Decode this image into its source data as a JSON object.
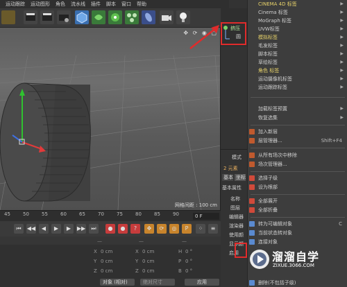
{
  "menubar": {
    "items": [
      "运动跟踪",
      "运动图形",
      "角色",
      "流水线",
      "插件",
      "脚本",
      "窗口",
      "帮助"
    ]
  },
  "objects": {
    "item1": "挤压",
    "item2": "圆"
  },
  "viewport": {
    "corner_icons": "✥ ⟳ ◉ ▢",
    "grid_readout": "网格间距 : 100 cm"
  },
  "timeline": {
    "ticks": [
      "45",
      "50",
      "55",
      "60",
      "65",
      "70",
      "75",
      "80",
      "85",
      "90"
    ],
    "frame_value": "0 F"
  },
  "coords": {
    "rows": [
      {
        "axis": "X",
        "pos": "0 cm",
        "size": "0 cm",
        "rot_axis": "H",
        "rot": "0 °"
      },
      {
        "axis": "Y",
        "pos": "0 cm",
        "size": "0 cm",
        "rot_axis": "P",
        "rot": "0 °"
      },
      {
        "axis": "Z",
        "pos": "0 cm",
        "size": "0 cm",
        "rot_axis": "B",
        "rot": "0 °"
      }
    ],
    "mode_select": "对象 (相对)",
    "size_select": "绝对尺寸",
    "apply_button": "应用"
  },
  "attr": {
    "mode_label": "模式",
    "elements_label": "2 元素",
    "base_tab": "基本",
    "coord_tab": "坐标",
    "basic_props": "基本属性",
    "name_label": "名称",
    "layer_label": "图层",
    "editor_label": "编辑器",
    "renderer_label": "渲染器",
    "use_color_label": "使用颜",
    "display_color_label": "显示颜",
    "enable_label": "启用"
  },
  "context_menu": {
    "items": [
      {
        "label": "CINEMA 4D 标签",
        "submenu": true,
        "style": "yellow"
      },
      {
        "label": "Cinema 标签",
        "submenu": true
      },
      {
        "label": "MoGraph 标签",
        "submenu": true
      },
      {
        "label": "UVW标签",
        "submenu": true
      },
      {
        "label": "模拟标签",
        "submenu": true,
        "style": "yellow"
      },
      {
        "label": "毛发标签",
        "submenu": true
      },
      {
        "label": "脚本标签",
        "submenu": true
      },
      {
        "label": "草绘标签",
        "submenu": true
      },
      {
        "label": "角色 标签",
        "submenu": true,
        "style": "yellow"
      },
      {
        "label": "运动摄像机标签",
        "submenu": true
      },
      {
        "label": "运动跟踪标签",
        "submenu": true
      },
      {
        "label": "加载标签预置",
        "submenu": true
      },
      {
        "label": "恢复选集",
        "submenu": true
      },
      {
        "label": "加入新层",
        "icon": "#c05a2e"
      },
      {
        "label": "层管理器...",
        "icon": "#c05a2e",
        "shortcut": "Shift+F4"
      },
      {
        "label": "从所有场次中移除",
        "icon": "#c05a2e"
      },
      {
        "label": "场次管理器...",
        "icon": "#c05a2e"
      },
      {
        "label": "选择子级",
        "icon": "#d04a3a"
      },
      {
        "label": "设为根部",
        "icon": "#d04a3a"
      },
      {
        "label": "全部展开",
        "icon": "#d04a3a"
      },
      {
        "label": "全部折叠",
        "icon": "#d04a3a"
      },
      {
        "label": "转为可编辑对象",
        "icon": "#5a8ad0",
        "shortcut": "C"
      },
      {
        "label": "当前状态转对象",
        "icon": "#5a8ad0"
      },
      {
        "label": "连接对象",
        "icon": "#5a8ad0"
      },
      {
        "label": "删除(不包括子级)",
        "icon": "#5a8ad0"
      }
    ]
  },
  "watermark": {
    "title": "溜溜自学",
    "url": "ZIXUE.3066.COM"
  },
  "colors": {
    "highlight_red": "#e12b2b",
    "menu_yellow": "#e8d36a"
  }
}
